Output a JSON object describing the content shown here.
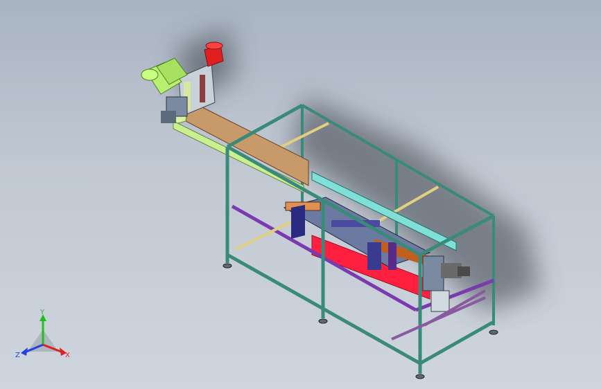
{
  "viewport": {
    "background_top": "#a9b4c2",
    "background_bottom": "#cfd5dd"
  },
  "model": {
    "frame_color": "#3a8a7a",
    "rail_color": "#e0e080",
    "conveyor_color": "#c8a070",
    "cylinder_color": "#b8f070",
    "motor_color": "#e02020",
    "base_plate_color": "#ff2040",
    "bracket_color": "#6a3aa0"
  },
  "triad": {
    "y_label": "Y",
    "x_label": "X",
    "z_label": "Z",
    "y_color": "#20c020",
    "x_color": "#e02020",
    "z_color": "#2040e0"
  }
}
